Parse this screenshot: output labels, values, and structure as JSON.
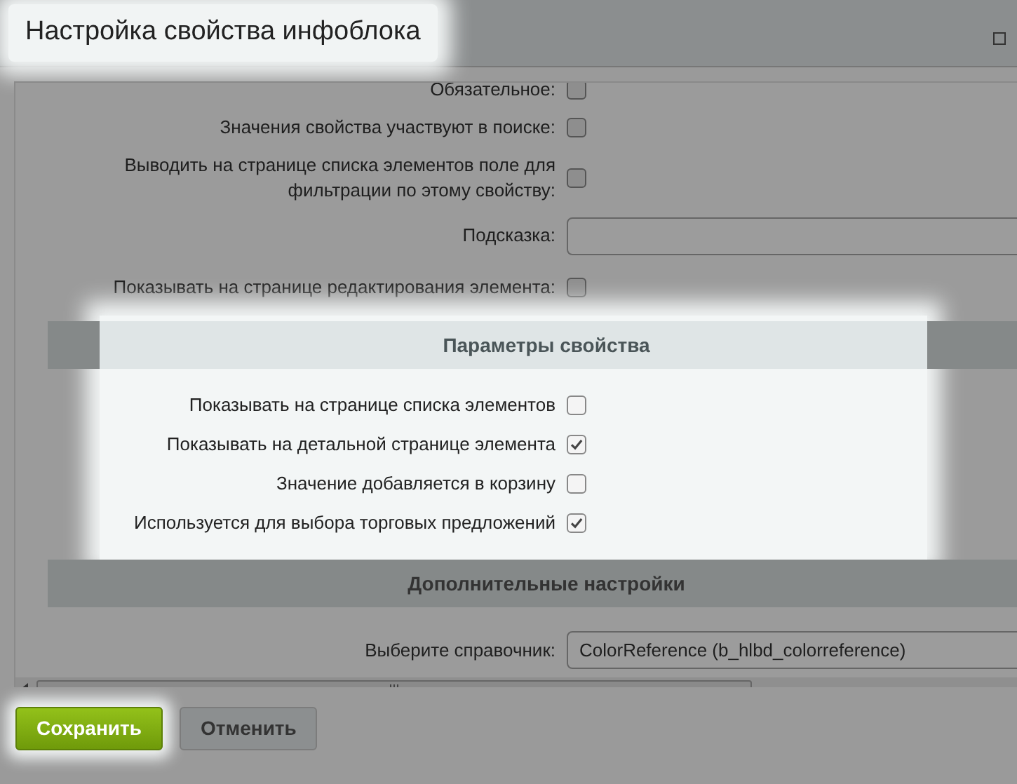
{
  "window": {
    "title": "Настройка свойства инфоблока",
    "title_highlighted": true
  },
  "rows": [
    {
      "kind": "checkbox",
      "label": "Обязательное:",
      "checked": false
    },
    {
      "kind": "checkbox",
      "label": "Значения свойства участвуют в поиске:",
      "checked": false
    },
    {
      "kind": "checkbox",
      "label": "Выводить на странице списка элементов поле для фильтрации по этому свойству:",
      "checked": false
    },
    {
      "kind": "text",
      "label": "Подсказка:"
    },
    {
      "kind": "checkbox",
      "label": "Показывать на странице редактирования элемента:",
      "checked": false
    }
  ],
  "sections": [
    {
      "heading": "Параметры свойства",
      "highlighted": true,
      "rows": [
        {
          "kind": "checkbox",
          "label": "Показывать на странице списка элементов",
          "checked": false
        },
        {
          "kind": "checkbox",
          "label": "Показывать на детальной странице элемента",
          "checked": true
        },
        {
          "kind": "checkbox",
          "label": "Значение добавляется в корзину",
          "checked": false
        },
        {
          "kind": "checkbox",
          "label": "Используется для выбора торговых предложений",
          "checked": true
        }
      ]
    },
    {
      "heading": "Дополнительные настройки",
      "highlighted": false,
      "rows": [
        {
          "kind": "select",
          "label": "Выберите справочник:",
          "value": "ColorReference (b_hlbd_colorreference)"
        }
      ]
    }
  ],
  "buttons": [
    {
      "label": "Сохранить",
      "kind": "primary",
      "highlighted": true
    },
    {
      "label": "Отменить",
      "kind": "secondary",
      "highlighted": false
    }
  ]
}
